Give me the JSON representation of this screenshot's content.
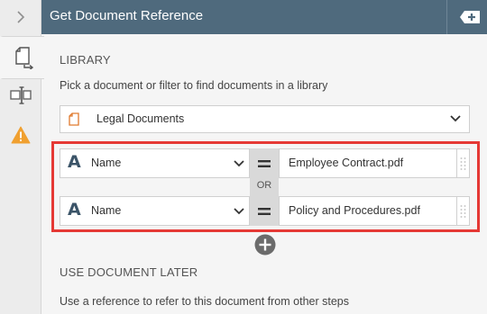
{
  "header": {
    "title": "Get Document Reference",
    "action_icon": "add-tag-icon"
  },
  "rail": {
    "collapse_icon": "chevron-right-icon",
    "items": [
      {
        "icon": "document-reference-icon",
        "active": true
      },
      {
        "icon": "text-cursor-icon",
        "active": false
      },
      {
        "icon": "warning-icon",
        "active": false,
        "color": "#f0a030"
      }
    ]
  },
  "library": {
    "section_label": "LIBRARY",
    "help_text": "Pick a document or filter to find documents in a library",
    "selected": "Legal Documents",
    "icon": "document-icon",
    "icon_color": "#e07a2e"
  },
  "filters": {
    "operator_join": "OR",
    "rows": [
      {
        "field": "Name",
        "field_icon": "text-field-icon",
        "operator": "=",
        "value": "Employee Contract.pdf"
      },
      {
        "field": "Name",
        "field_icon": "text-field-icon",
        "operator": "=",
        "value": "Policy and Procedures.pdf"
      }
    ],
    "highlight_color": "#e53935",
    "add_icon": "add-circle-icon"
  },
  "later": {
    "section_label": "USE DOCUMENT LATER",
    "help_text": "Use a reference to refer to this document from other steps"
  },
  "colors": {
    "header_bg": "#4f6a7d",
    "field_icon": "#3b5468"
  }
}
